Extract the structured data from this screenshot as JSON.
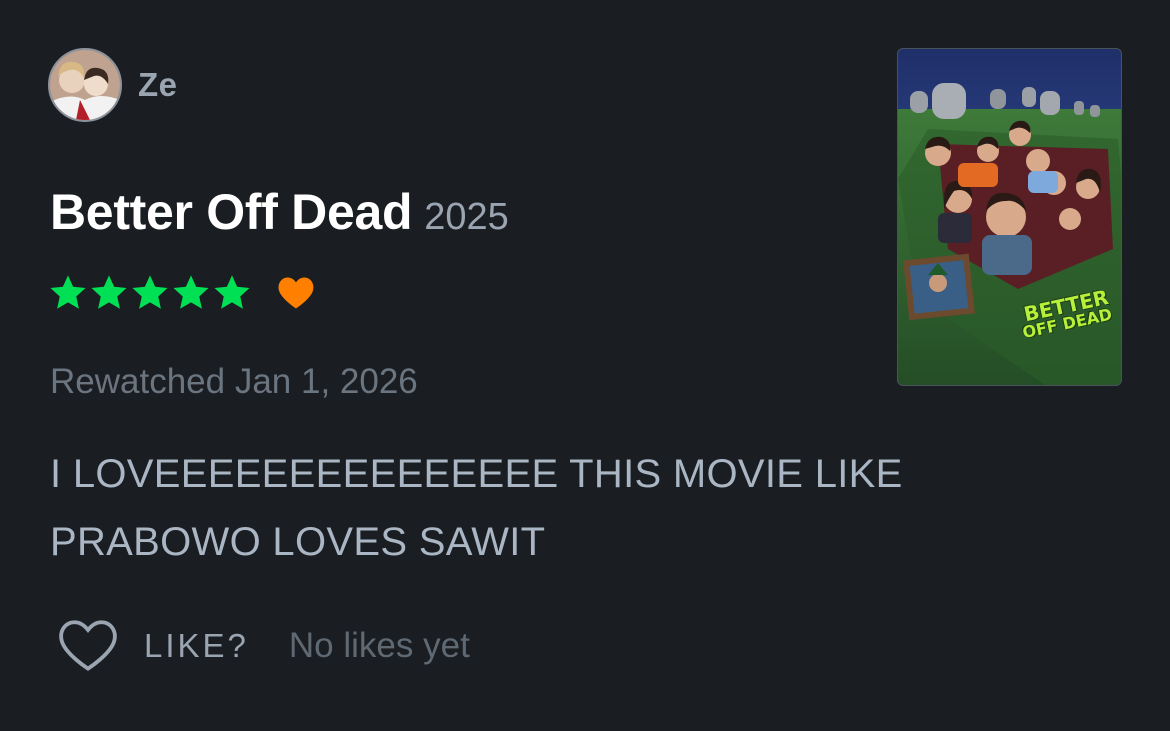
{
  "reviewer": {
    "name": "Ze"
  },
  "film": {
    "title": "Better Off Dead",
    "year": "2025",
    "rating_stars": 5,
    "liked": true,
    "poster_title_line1": "BETTER",
    "poster_title_line2": "OFF DEAD"
  },
  "review": {
    "watch_status": "Rewatched Jan 1, 2026",
    "text": "I LOVEEEEEEEEEEEEEEE THIS MOVIE LIKE PRABOWO LOVES SAWIT"
  },
  "actions": {
    "like_label": "LIKE?",
    "likes_count": "No likes yet"
  },
  "icons": {
    "rating": "star-icon",
    "liked": "heart-icon",
    "like_action": "heart-outline-icon"
  },
  "colors": {
    "background": "#1a1d22",
    "star": "#00e054",
    "heart": "#ff8000",
    "title": "#ffffff",
    "muted": "#9aa5b1"
  }
}
